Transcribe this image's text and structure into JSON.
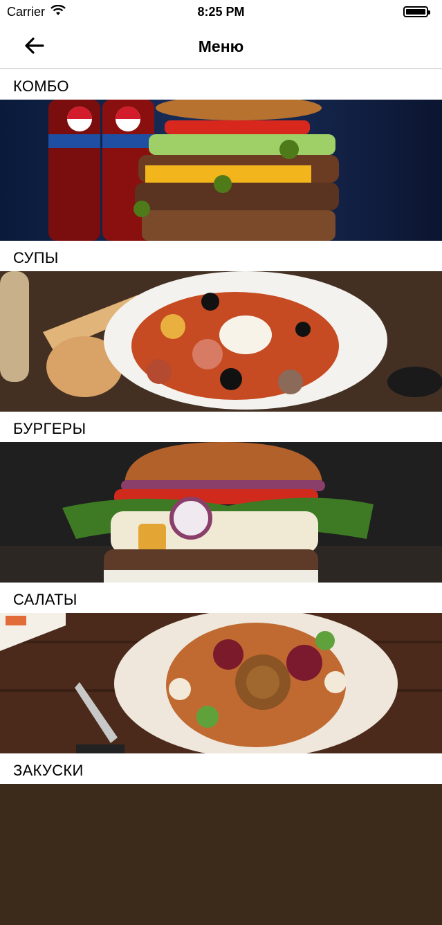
{
  "status_bar": {
    "carrier": "Carrier",
    "time": "8:25 PM",
    "battery_level": 1.0
  },
  "nav": {
    "title": "Меню",
    "back_icon": "arrow-left-icon"
  },
  "categories": [
    {
      "label": "КОМБО"
    },
    {
      "label": "СУПЫ"
    },
    {
      "label": "БУРГЕРЫ"
    },
    {
      "label": "САЛАТЫ"
    },
    {
      "label": "ЗАКУСКИ"
    }
  ]
}
